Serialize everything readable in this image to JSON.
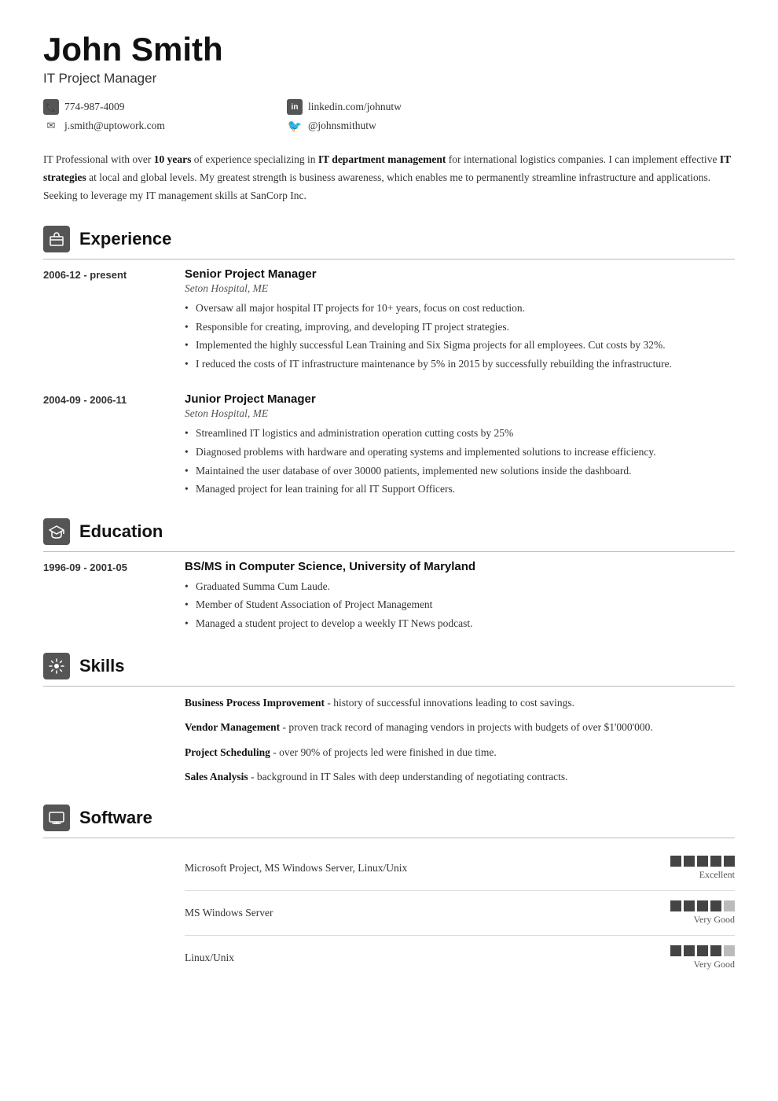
{
  "header": {
    "name": "John Smith",
    "title": "IT Project Manager",
    "contacts": [
      {
        "type": "phone",
        "icon_label": "phone",
        "value": "774-987-4009"
      },
      {
        "type": "linkedin",
        "icon_label": "in",
        "value": "linkedin.com/johnutw"
      },
      {
        "type": "email",
        "icon_label": "✉",
        "value": "j.smith@uptowork.com"
      },
      {
        "type": "twitter",
        "icon_label": "🐦",
        "value": "@johnsmithutw"
      }
    ]
  },
  "summary": "IT Professional with over 10 years of experience specializing in IT department management for international logistics companies. I can implement effective IT strategies at local and global levels. My greatest strength is business awareness, which enables me to permanently streamline infrastructure and applications. Seeking to leverage my IT management skills at SanCorp Inc.",
  "sections": {
    "experience": {
      "title": "Experience",
      "icon": "💼",
      "entries": [
        {
          "date": "2006-12 - present",
          "job_title": "Senior Project Manager",
          "company": "Seton Hospital, ME",
          "bullets": [
            "Oversaw all major hospital IT projects for 10+ years, focus on cost reduction.",
            "Responsible for creating, improving, and developing IT project strategies.",
            "Implemented the highly successful Lean Training and Six Sigma projects for all employees. Cut costs by 32%.",
            "I reduced the costs of IT infrastructure maintenance by 5% in 2015 by successfully rebuilding the infrastructure."
          ]
        },
        {
          "date": "2004-09 - 2006-11",
          "job_title": "Junior Project Manager",
          "company": "Seton Hospital, ME",
          "bullets": [
            "Streamlined IT logistics and administration operation cutting costs by 25%",
            "Diagnosed problems with hardware and operating systems and implemented solutions to increase efficiency.",
            "Maintained the user database of over 30000 patients, implemented new solutions inside the dashboard.",
            "Managed project for lean training for all IT Support Officers."
          ]
        }
      ]
    },
    "education": {
      "title": "Education",
      "icon": "🎓",
      "entries": [
        {
          "date": "1996-09 - 2001-05",
          "degree": "BS/MS in Computer Science, University of Maryland",
          "bullets": [
            "Graduated Summa Cum Laude.",
            "Member of Student Association of Project Management",
            "Managed a student project to develop a weekly IT News podcast."
          ]
        }
      ]
    },
    "skills": {
      "title": "Skills",
      "icon": "🔧",
      "items": [
        {
          "name": "Business Process Improvement",
          "desc": "history of successful innovations leading to cost savings."
        },
        {
          "name": "Vendor Management",
          "desc": "proven track record of managing vendors in projects with budgets of over $1'000'000."
        },
        {
          "name": "Project Scheduling",
          "desc": "over 90% of projects led were finished in due time."
        },
        {
          "name": "Sales Analysis",
          "desc": "background in IT Sales with deep understanding of negotiating contracts."
        }
      ]
    },
    "software": {
      "title": "Software",
      "icon": "🖥",
      "items": [
        {
          "name": "Microsoft Project, MS Windows Server, Linux/Unix",
          "filled": 5,
          "total": 5,
          "label": "Excellent"
        },
        {
          "name": "MS Windows Server",
          "filled": 4,
          "total": 5,
          "label": "Very Good"
        },
        {
          "name": "Linux/Unix",
          "filled": 4,
          "total": 5,
          "label": "Very Good"
        }
      ]
    }
  },
  "colors": {
    "accent": "#444444",
    "muted": "#555555",
    "border": "#bbbbbb"
  }
}
